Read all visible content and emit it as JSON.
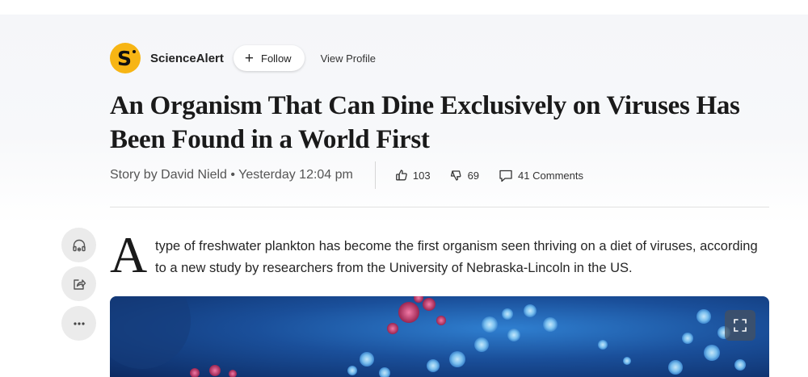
{
  "publisher": {
    "logo_letter": "S",
    "name": "ScienceAlert",
    "follow_label": "Follow",
    "view_profile_label": "View Profile"
  },
  "article": {
    "title": "An Organism That Can Dine Exclusively on Viruses Has Been Found in a World First",
    "byline": "Story by David Nield • Yesterday 12:04 pm",
    "likes": "103",
    "dislikes": "69",
    "comments": "41 Comments",
    "dropcap": "A",
    "lead_text": "type of freshwater plankton has become the first organism seen thriving on a diet of viruses, according to a new study by researchers from the University of Nebraska-Lincoln in the US."
  },
  "side_actions": [
    "headphones-icon",
    "share-icon",
    "more-icon"
  ],
  "colors": {
    "logo_bg": "#f7b514",
    "hero_blue": "#1a4f9a"
  }
}
